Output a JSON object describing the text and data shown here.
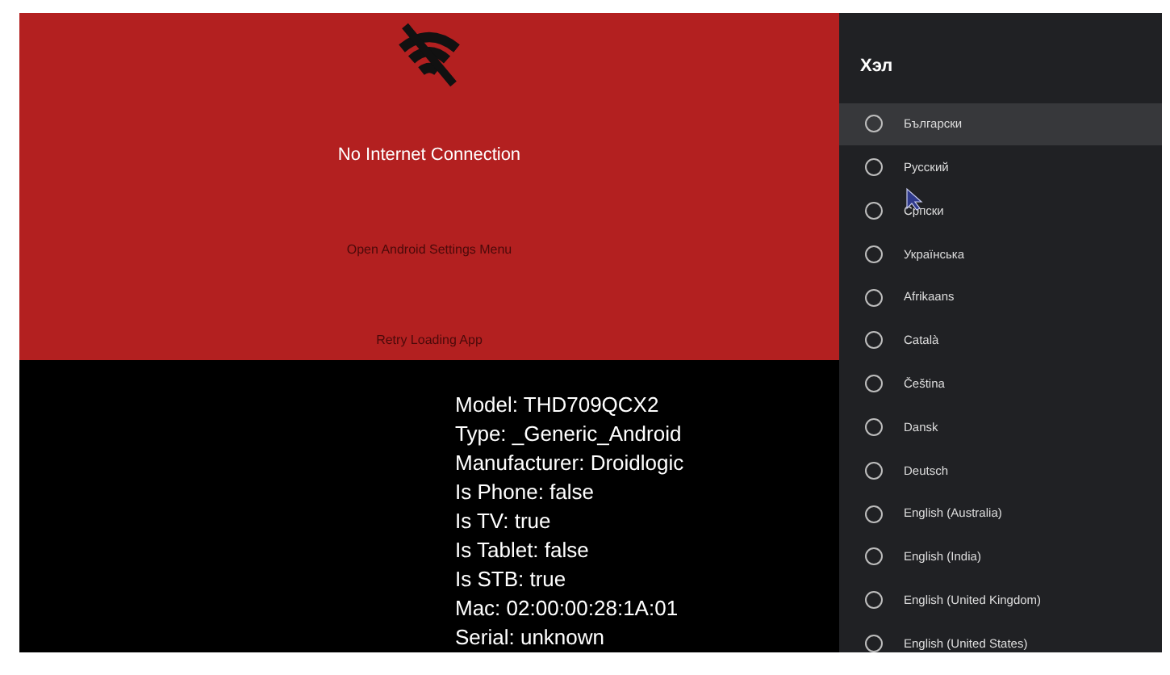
{
  "error_screen": {
    "message": "No Internet Connection",
    "buttons": [
      "Open Android Settings Menu",
      "Retry Loading App"
    ]
  },
  "device_info": [
    "Model: THD709QCX2",
    "Type: _Generic_Android",
    "Manufacturer: Droidlogic",
    "Is Phone: false",
    "Is TV: true",
    "Is Tablet: false",
    "Is STB: true",
    "Mac: 02:00:00:28:1A:01",
    "Serial: unknown"
  ],
  "language_panel": {
    "title": "Хэл",
    "items": [
      {
        "label": "Български",
        "selected": true,
        "checked": false
      },
      {
        "label": "Русский",
        "selected": false,
        "checked": false
      },
      {
        "label": "Српски",
        "selected": false,
        "checked": false
      },
      {
        "label": "Українська",
        "selected": false,
        "checked": false
      },
      {
        "label": "Afrikaans",
        "selected": false,
        "checked": false
      },
      {
        "label": "Català",
        "selected": false,
        "checked": false
      },
      {
        "label": "Čeština",
        "selected": false,
        "checked": false
      },
      {
        "label": "Dansk",
        "selected": false,
        "checked": false
      },
      {
        "label": "Deutsch",
        "selected": false,
        "checked": false
      },
      {
        "label": "English (Australia)",
        "selected": false,
        "checked": false
      },
      {
        "label": "English (India)",
        "selected": false,
        "checked": false
      },
      {
        "label": "English (United Kingdom)",
        "selected": false,
        "checked": false
      },
      {
        "label": "English (United States)",
        "selected": false,
        "checked": false
      }
    ]
  }
}
